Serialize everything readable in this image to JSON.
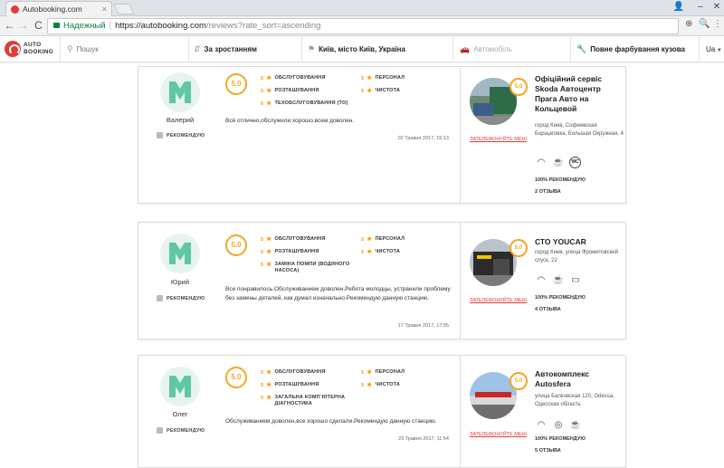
{
  "browser": {
    "tab_title": "Autobooking.com",
    "tab_close": "×",
    "secure_label": "Надежный",
    "url_host": "https://autobooking.com",
    "url_path": "/reviews?rate_sort=ascending",
    "back": "←",
    "forward": "→",
    "reload": "C"
  },
  "header": {
    "logo_line1": "AUTO",
    "logo_line2": "BOOKING",
    "search_placeholder": "Пошук",
    "sort_label": "За зростанням",
    "location": "Київ, місто Київ, Україна",
    "car_placeholder": "Автомобіль",
    "service": "Повне фарбування кузова",
    "language": "Ua"
  },
  "colors": {
    "accent": "#f5a623",
    "brand": "#e53935",
    "avatar": "#5fc7a4"
  },
  "reviews": [
    {
      "user": "Валерий",
      "recommend": "РЕКОМЕНДУЮ",
      "score": "5.0",
      "ratings_left": [
        {
          "num": "5",
          "label": "ОБСЛУГОВУВАННЯ"
        },
        {
          "num": "5",
          "label": "РОЗТАШУВАННЯ"
        },
        {
          "num": "5",
          "label": "ТЕХОБСЛУГОВУВАННЯ (ТО)"
        }
      ],
      "ratings_right": [
        {
          "num": "5",
          "label": "ПЕРСОНАЛ"
        },
        {
          "num": "5",
          "label": "ЧИСТОТА"
        }
      ],
      "text": "Всё отлично,обслужили хорошо,всем доволен.",
      "date": "02 Травня 2017, 15:13",
      "station": {
        "score": "5.0",
        "name": "Офіційний сервіс Skoda Автоцентр Прага Авто на Кольцевой",
        "address": "город Киев, Софиевская Борщаговка, Большая Окружная, 4",
        "phone": "ЗАТЕЛЕФОНУЙТЕ МЕНІ",
        "amenities": [
          "wifi-icon",
          "coffee-icon",
          "wc-icon"
        ],
        "wc_text": "WC",
        "recommend": "100% РЕКОМЕНДУЮ",
        "reviews": "2 ОТЗЫВА"
      }
    },
    {
      "user": "Юрий",
      "recommend": "РЕКОМЕНДУЮ",
      "score": "5.0",
      "ratings_left": [
        {
          "num": "5",
          "label": "ОБСЛУГОВУВАННЯ"
        },
        {
          "num": "5",
          "label": "РОЗТАШУВАННЯ"
        },
        {
          "num": "5",
          "label": "ЗАМІНА ПОМПИ (ВОДЯНОГО НАСОСА)"
        }
      ],
      "ratings_right": [
        {
          "num": "5",
          "label": "ПЕРСОНАЛ"
        },
        {
          "num": "5",
          "label": "ЧИСТОТА"
        }
      ],
      "text": "Все понравилось.Обслуживанием доволен.Ребята молодцы, устранили проблему без замены деталей, как думал изначально.Рекомендую данную станцию.",
      "date": "17 Травня 2017, 17:55",
      "station": {
        "score": "5.0",
        "name": "СТО YOUCAR",
        "address": "город Киев, улица Фрометовский спуск, 22",
        "phone": "ЗАТЕЛЕФОНУЙТЕ МЕНІ",
        "amenities": [
          "wifi-icon",
          "coffee-icon",
          "monitor-icon"
        ],
        "recommend": "100% РЕКОМЕНДУЮ",
        "reviews": "4 ОТЗЫВА"
      }
    },
    {
      "user": "Олег",
      "recommend": "РЕКОМЕНДУЮ",
      "score": "5.0",
      "ratings_left": [
        {
          "num": "5",
          "label": "ОБСЛУГОВУВАННЯ"
        },
        {
          "num": "5",
          "label": "РОЗТАШУВАННЯ"
        },
        {
          "num": "5",
          "label": "ЗАГАЛЬНА КОМП`ЮТЕРНА ДІАГНОСТИКА"
        }
      ],
      "ratings_right": [
        {
          "num": "5",
          "label": "ПЕРСОНАЛ"
        },
        {
          "num": "5",
          "label": "ЧИСТОТА"
        }
      ],
      "text": "Обслуживанием доволен,все хорошо сделали.Рекомендую данную станцию.",
      "date": "23 Травня 2017, 11:54",
      "station": {
        "score": "5.0",
        "name": "Автокомплекс Autosfera",
        "address": "улица Балковская 120, Odessa, Одесская область",
        "phone": "ЗАТЕЛЕФОНУЙТЕ МЕНІ",
        "amenities": [
          "wifi-icon",
          "waiting-room-icon",
          "coffee-icon"
        ],
        "recommend": "100% РЕКОМЕНДУЮ",
        "reviews": "5 ОТЗЫВА"
      }
    }
  ]
}
